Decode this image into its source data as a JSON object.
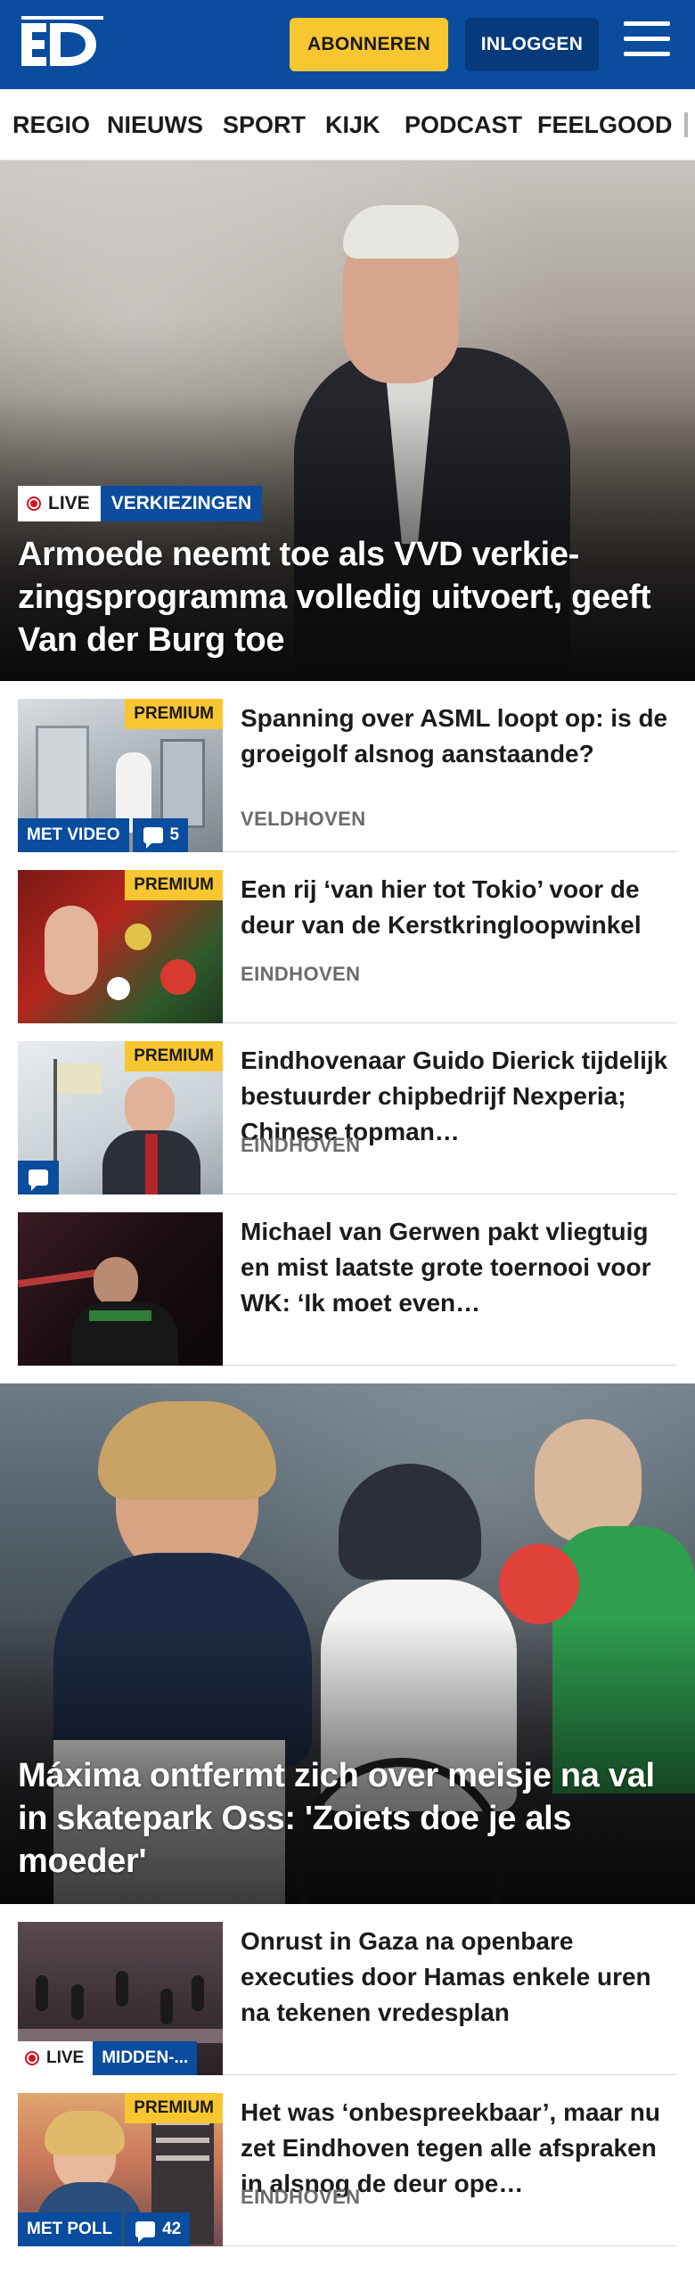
{
  "header": {
    "logo_text": "ED",
    "subscribe_label": "ABONNEREN",
    "login_label": "INLOGGEN",
    "menu_icon": "hamburger-icon",
    "brand_color": "#0a4c9e",
    "accent_color": "#f8c630"
  },
  "nav": {
    "items": [
      "REGIO",
      "NIEUWS",
      "SPORT",
      "KIJK",
      "PODCAST",
      "FEELGOOD"
    ]
  },
  "hero1": {
    "live_label": "LIVE",
    "category": "VERKIEZINGEN",
    "title": "Armoede neemt toe als VVD verkie­zingsprogramma volledig uitvoert, geeft Van der Burg toe"
  },
  "articles": [
    {
      "title": "Spanning over ASML loopt op: is de groeigolf alsnog aanstaande?",
      "location": "VELDHOVEN",
      "premium_label": "PREMIUM",
      "video_label": "MET VIDEO",
      "comments": "5"
    },
    {
      "title": "Een rij ‘van hier tot Tokio’ voor de deur van de Kerstkringloopwin­kel",
      "location": "EINDHOVEN",
      "premium_label": "PREMIUM"
    },
    {
      "title": "Eindhovenaar Guido Dierick tijdelijk bestuurder chipbedrijf Nexperia; Chinese topman…",
      "location": "EINDHOVEN",
      "premium_label": "PREMIUM"
    },
    {
      "title": "Michael van Gerwen pakt vliegtuig en mist laatste grote toernooi voor WK: ‘Ik moet even…"
    }
  ],
  "hero2": {
    "title": "Máxima ontfermt zich over meisje na val in skatepark Oss: 'Zoiets doe je als moeder'"
  },
  "articles2": [
    {
      "title": "Onrust in Gaza na openbare executies door Hamas enkele uren na tekenen vredesplan",
      "live_label": "LIVE",
      "category": "MIDDEN-..."
    },
    {
      "title": "Het was ‘onbespreekbaar’, maar nu zet Eindhoven tegen alle afspraken in alsnog de deur ope…",
      "location": "EINDHOVEN",
      "premium_label": "PREMIUM",
      "poll_label": "MET POLL",
      "comments": "42"
    }
  ]
}
